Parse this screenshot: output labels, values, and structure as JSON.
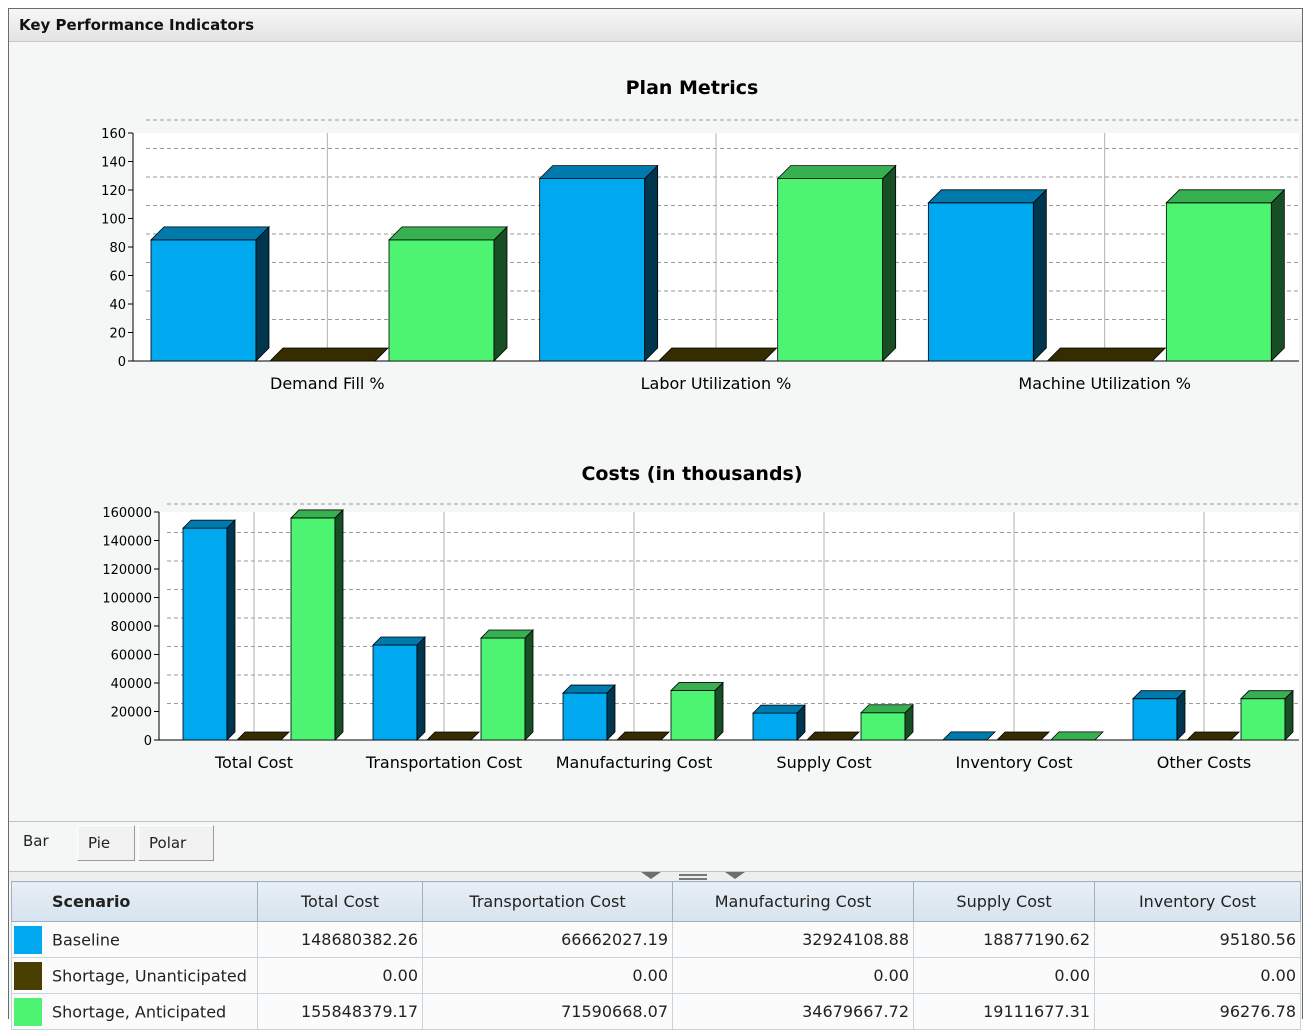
{
  "panel": {
    "title": "Key Performance Indicators"
  },
  "colors": {
    "baseline": "#00a8f0",
    "unanticipated": "#4a3f00",
    "anticipated": "#4cf472"
  },
  "chart_data": [
    {
      "type": "bar",
      "title": "Plan Metrics",
      "categories": [
        "Demand Fill %",
        "Labor Utilization %",
        "Machine Utilization %"
      ],
      "series": [
        {
          "values": [
            85,
            128,
            111
          ]
        },
        {
          "values": [
            0,
            0,
            0
          ]
        },
        {
          "values": [
            85,
            128,
            111
          ]
        }
      ],
      "ylim": [
        0,
        160
      ],
      "yticks": [
        "0",
        "20",
        "40",
        "60",
        "80",
        "100",
        "120",
        "140",
        "160"
      ],
      "grid": true
    },
    {
      "type": "bar",
      "title": "Costs (in thousands)",
      "categories": [
        "Total Cost",
        "Transportation Cost",
        "Manufacturing Cost",
        "Supply Cost",
        "Inventory Cost",
        "Other Costs"
      ],
      "series": [
        {
          "values": [
            148680,
            66662,
            32924,
            18877,
            95,
            29000
          ]
        },
        {
          "values": [
            0,
            0,
            0,
            0,
            0,
            0
          ]
        },
        {
          "values": [
            155848,
            71591,
            34680,
            19112,
            96,
            29000
          ]
        }
      ],
      "ylim": [
        0,
        160000
      ],
      "yticks": [
        "0",
        "20000",
        "40000",
        "60000",
        "80000",
        "100000",
        "120000",
        "140000",
        "160000"
      ],
      "grid": true
    }
  ],
  "tabs": [
    "Bar",
    "Pie",
    "Polar"
  ],
  "active_tab": "Bar",
  "table": {
    "headers": [
      "Scenario",
      "Total Cost",
      "Transportation Cost",
      "Manufacturing Cost",
      "Supply Cost",
      "Inventory Cost"
    ],
    "rows": [
      {
        "name": "Baseline",
        "color": "#00a8f0",
        "cells": [
          "148680382.26",
          "66662027.19",
          "32924108.88",
          "18877190.62",
          "95180.56"
        ]
      },
      {
        "name": "Shortage, Unanticipated",
        "color": "#4a3f00",
        "cells": [
          "0.00",
          "0.00",
          "0.00",
          "0.00",
          "0.00"
        ]
      },
      {
        "name": "Shortage, Anticipated",
        "color": "#4cf472",
        "cells": [
          "155848379.17",
          "71590668.07",
          "34679667.72",
          "19111677.31",
          "96276.78"
        ]
      }
    ]
  }
}
